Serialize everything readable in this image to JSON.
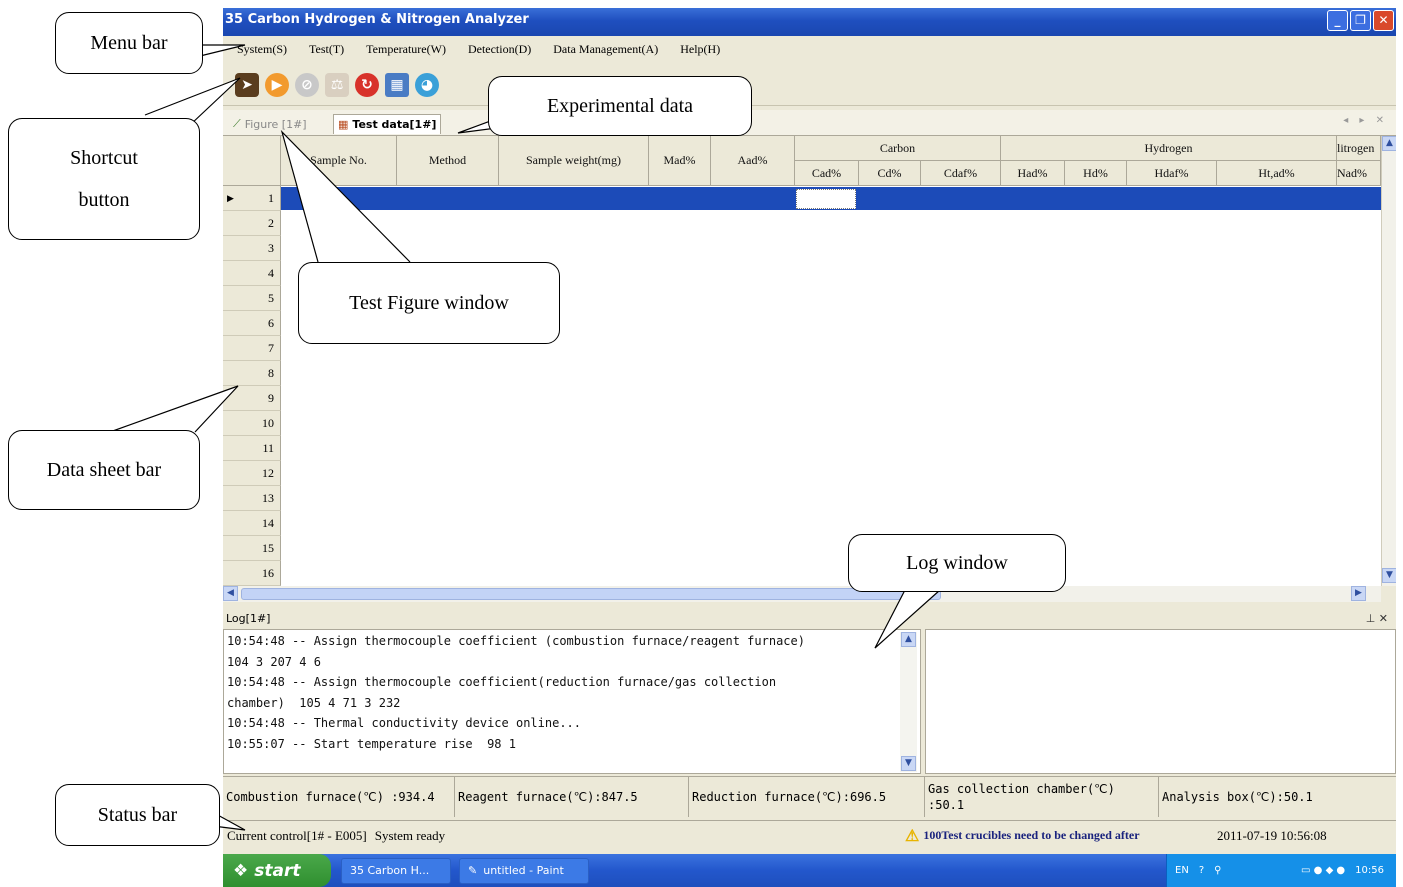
{
  "window": {
    "title": "35 Carbon Hydrogen & Nitrogen Analyzer"
  },
  "menu": [
    "System(S)",
    "Test(T)",
    "Temperature(W)",
    "Detection(D)",
    "Data Management(A)",
    "Help(H)"
  ],
  "toolbar_icons": [
    "connect-icon",
    "start-icon",
    "stop-icon",
    "calibrate-icon",
    "refresh-icon",
    "report-icon",
    "database-icon"
  ],
  "tabs": [
    "Figure [1#]",
    "Test data[1#]"
  ],
  "grid": {
    "columns": [
      "Sample No.",
      "Method",
      "Sample weight(mg)",
      "Mad%",
      "Aad%"
    ],
    "groups": [
      "Carbon",
      "Hydrogen",
      "litrogen"
    ],
    "subcolumns": [
      "Cad%",
      "Cd%",
      "Cdaf%",
      "Had%",
      "Hd%",
      "Hdaf%",
      "Ht,ad%",
      "Nad%"
    ],
    "rows": [
      "1",
      "2",
      "3",
      "4",
      "5",
      "6",
      "7",
      "8",
      "9",
      "10",
      "11",
      "12",
      "13",
      "14",
      "15",
      "16"
    ]
  },
  "log": {
    "title": "Log[1#]",
    "lines": [
      "10:54:48 -- Assign thermocouple coefficient (combustion furnace/reagent furnace)",
      "104 3 207 4 6",
      "10:54:48 -- Assign thermocouple coefficient(reduction furnace/gas collection",
      "chamber)  105 4 71 3 232",
      "10:54:48 -- Thermal conductivity device online...",
      "10:55:07 -- Start temperature rise  98 1"
    ]
  },
  "temps": [
    "Combustion furnace(℃) :934.4",
    "Reagent furnace(℃):847.5",
    "Reduction furnace(℃):696.5",
    "Gas collection chamber(℃) :50.1",
    "Analysis box(℃):50.1"
  ],
  "status": {
    "control": "Current control[1# - E005]",
    "state": "System ready",
    "warning": "100Test crucibles need to be changed after",
    "datetime": "2011-07-19 10:56:08"
  },
  "taskbar": {
    "start": "start",
    "tasks": [
      "35 Carbon H...",
      "untitled - Paint"
    ],
    "lang": "EN",
    "clock": "10:56"
  },
  "callouts": [
    "Menu bar",
    "Shortcut",
    "button",
    "Experimental data",
    "Test Figure window",
    "Data sheet bar",
    "Log window",
    "Status bar"
  ]
}
